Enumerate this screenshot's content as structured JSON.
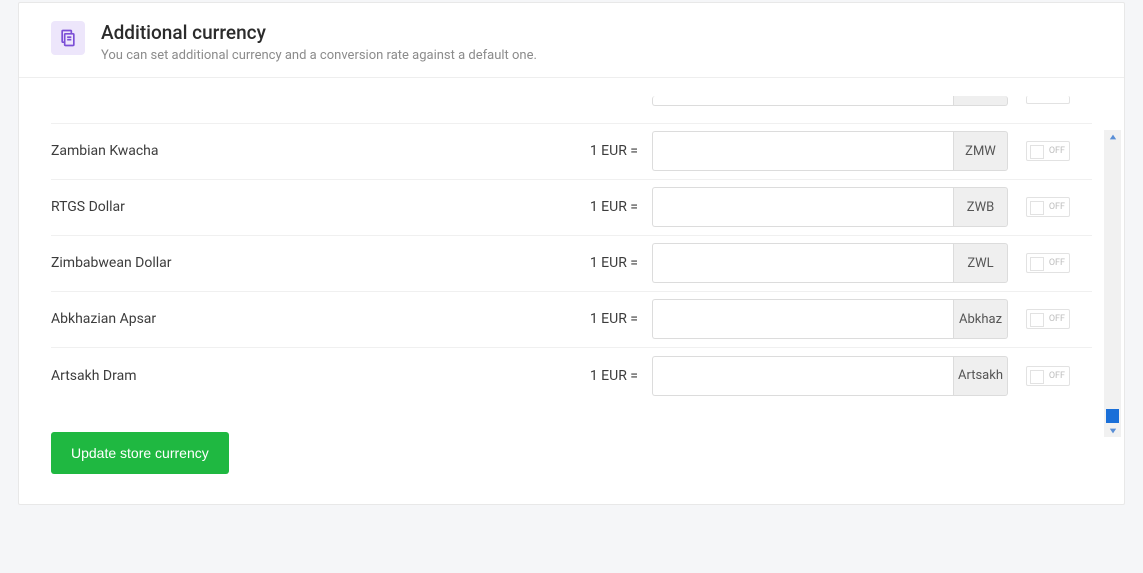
{
  "header": {
    "title": "Additional currency",
    "subtitle": "You can set additional currency and a conversion rate against a default one."
  },
  "base_label": "1 EUR =",
  "toggle_off_label": "OFF",
  "rows": [
    {
      "name": "",
      "code": "",
      "partial": true
    },
    {
      "name": "Zambian Kwacha",
      "code": "ZMW"
    },
    {
      "name": "RTGS Dollar",
      "code": "ZWB"
    },
    {
      "name": "Zimbabwean Dollar",
      "code": "ZWL"
    },
    {
      "name": "Abkhazian Apsar",
      "code": "Abkhaz"
    },
    {
      "name": "Artsakh Dram",
      "code": "Artsakh"
    }
  ],
  "update_button_label": "Update store currency"
}
